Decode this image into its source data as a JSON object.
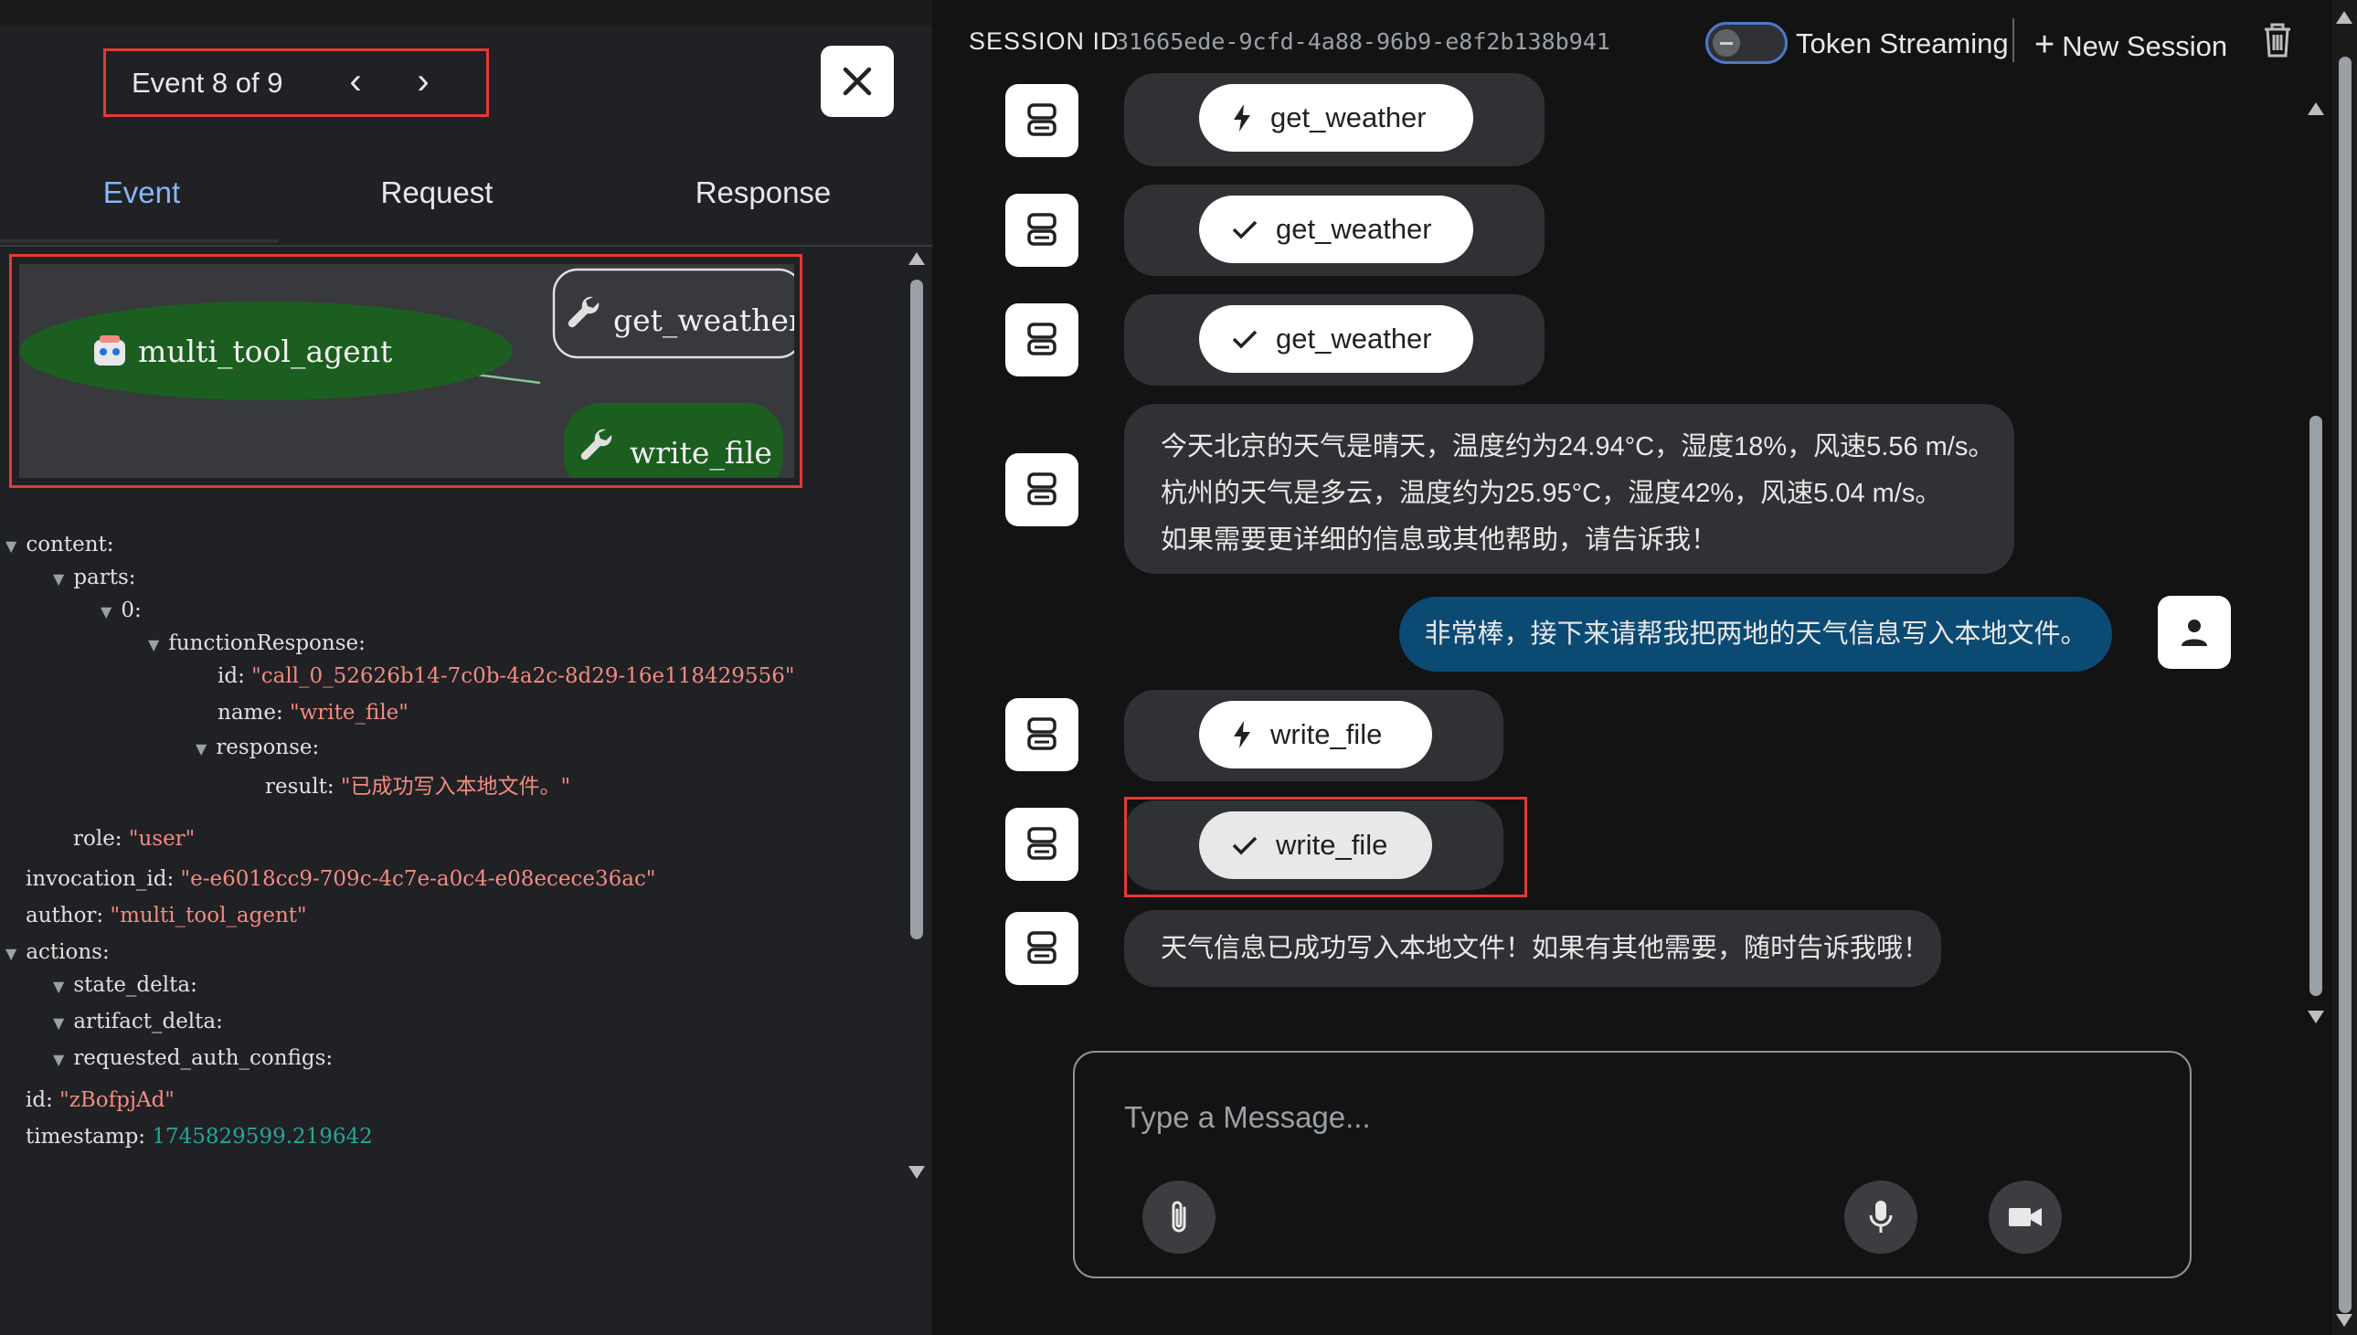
{
  "event_panel": {
    "nav_label": "Event 8 of 9",
    "tabs": [
      "Event",
      "Request",
      "Response"
    ],
    "active_tab": "Event",
    "graph": {
      "nodes": [
        {
          "label": "multi_tool_agent",
          "kind": "agent",
          "color": "#1b5e20"
        },
        {
          "label": "get_weather",
          "kind": "tool",
          "color": "#38393c"
        },
        {
          "label": "write_file",
          "kind": "tool",
          "color": "#1b5e20"
        }
      ],
      "edges": [
        {
          "from": "multi_tool_agent",
          "to": "get_weather",
          "color": "#e0e0e0"
        },
        {
          "from": "write_file",
          "to": "multi_tool_agent",
          "color": "#81c995"
        }
      ]
    },
    "tree": {
      "content_key": "content:",
      "parts_key": "parts:",
      "idx_key": "0:",
      "fr_key": "functionResponse:",
      "id_key": "id:",
      "id_val": "\"call_0_52626b14-7c0b-4a2c-8d29-16e118429556\"",
      "name_key": "name:",
      "name_val": "\"write_file\"",
      "response_key": "response:",
      "result_key": "result:",
      "result_val": "\"已成功写入本地文件。\"",
      "role_key": "role:",
      "role_val": "\"user\"",
      "invocation_key": "invocation_id:",
      "invocation_val": "\"e-e6018cc9-709c-4c7e-a0c4-e08ecece36ac\"",
      "author_key": "author:",
      "author_val": "\"multi_tool_agent\"",
      "actions_key": "actions:",
      "state_delta_key": "state_delta:",
      "artifact_delta_key": "artifact_delta:",
      "auth_key": "requested_auth_configs:",
      "eid_key": "id:",
      "eid_val": "\"zBofpjAd\"",
      "ts_key": "timestamp:",
      "ts_val": "1745829599.219642"
    }
  },
  "header": {
    "session_label": "SESSION ID",
    "session_id": "31665ede-9cfd-4a88-96b9-e8f2b138b941",
    "token_streaming_label": "Token Streaming",
    "token_streaming_on": false,
    "new_session_label": "New Session"
  },
  "messages": {
    "call1": "get_weather",
    "resp1": "get_weather",
    "resp2": "get_weather",
    "agent_text_1": "今天北京的天气是晴天，温度约为24.94°C，湿度18%，风速5.56 m/s。",
    "agent_text_2": "杭州的天气是多云，温度约为25.95°C，湿度42%，风速5.04 m/s。",
    "agent_text_3": "如果需要更详细的信息或其他帮助，请告诉我！",
    "user_text": "非常棒，接下来请帮我把两地的天气信息写入本地文件。",
    "call2": "write_file",
    "resp3": "write_file",
    "final_text": "天气信息已成功写入本地文件！如果有其他需要，随时告诉我哦！"
  },
  "input": {
    "placeholder": "Type a Message..."
  },
  "colors": {
    "accent": "#8ab4f8",
    "highlight": "#e53935",
    "user_bubble": "#0b4a73",
    "agent_bubble": "#303134"
  }
}
